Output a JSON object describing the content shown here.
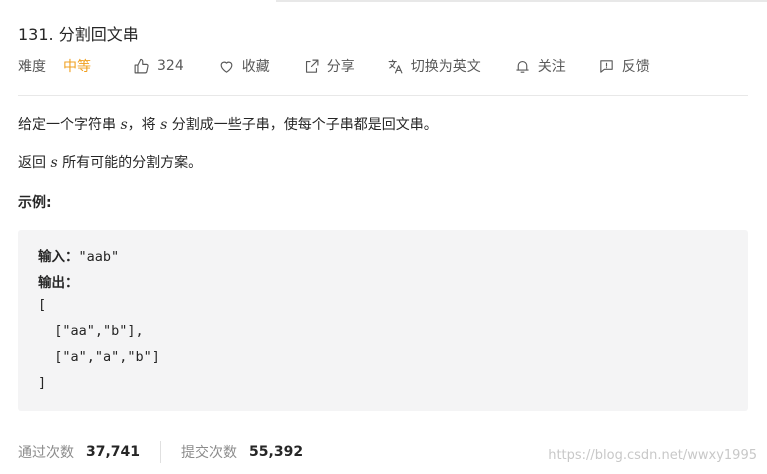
{
  "problem": {
    "title": "131. 分割回文串",
    "difficulty_label": "难度",
    "difficulty": "中等",
    "difficulty_color": "#f0a020"
  },
  "actions": {
    "likes": "324",
    "favorite": "收藏",
    "share": "分享",
    "switch_lang": "切换为英文",
    "follow": "关注",
    "feedback": "反馈"
  },
  "description": {
    "p1_a": "给定一个字符串 ",
    "p1_var": "s",
    "p1_b": "，将 ",
    "p1_var2": "s",
    "p1_c": " 分割成一些子串，使每个子串都是回文串。",
    "p2_a": "返回 ",
    "p2_var": "s",
    "p2_b": " 所有可能的分割方案。",
    "example_heading": "示例:"
  },
  "example": {
    "input_label": "输入：",
    "input_value": "\"aab\"",
    "output_label": "输出：",
    "lines": [
      "[",
      "  [\"aa\",\"b\"],",
      "  [\"a\",\"a\",\"b\"]",
      "]"
    ]
  },
  "stats": {
    "accepted_label": "通过次数",
    "accepted": "37,741",
    "submissions_label": "提交次数",
    "submissions": "55,392"
  },
  "watermark": "https://blog.csdn.net/wwxy1995",
  "icons": [
    "thumbs-up-icon",
    "heart-icon",
    "share-icon",
    "translate-icon",
    "bell-icon",
    "feedback-icon"
  ]
}
